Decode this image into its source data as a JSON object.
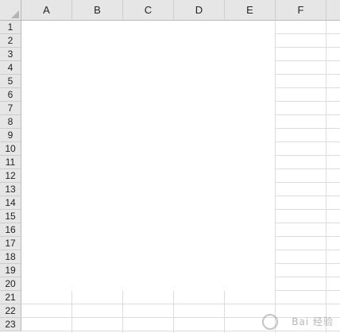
{
  "spreadsheet": {
    "columns": [
      "A",
      "B",
      "C",
      "D",
      "E",
      "F"
    ],
    "rows": [
      "1",
      "2",
      "3",
      "4",
      "5",
      "6",
      "7",
      "8",
      "9",
      "10",
      "11",
      "12",
      "13",
      "14",
      "15",
      "16",
      "17",
      "18",
      "19",
      "20",
      "21",
      "22",
      "23"
    ]
  },
  "watermark": {
    "text": "Bai 经验"
  },
  "colors": {
    "header_bg": "#e6e6e6",
    "gridline": "#dcdcdc",
    "header_border": "#b9b9b9"
  }
}
